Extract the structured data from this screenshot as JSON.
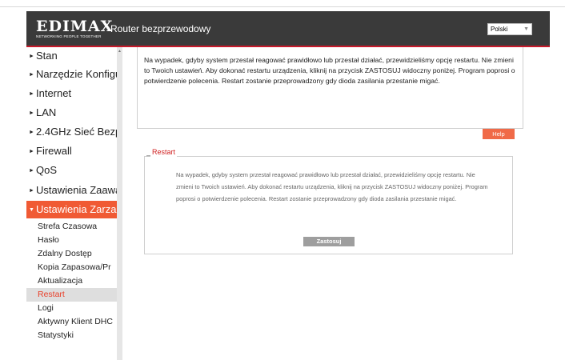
{
  "header": {
    "logo_text": "EDIMAX",
    "logo_tagline": "NETWORKING PEOPLE TOGETHER",
    "title": "Router bezprzewodowy",
    "language": "Polski"
  },
  "sidebar": {
    "items": [
      {
        "label": "Stan"
      },
      {
        "label": "Narzędzie Konfigu"
      },
      {
        "label": "Internet"
      },
      {
        "label": "LAN"
      },
      {
        "label": "2.4GHz Sieć Bezp"
      },
      {
        "label": "Firewall"
      },
      {
        "label": "QoS"
      },
      {
        "label": "Ustawienia Zaawa"
      },
      {
        "label": "Ustawienia Zarza"
      }
    ],
    "sub_items": [
      {
        "label": "Strefa Czasowa"
      },
      {
        "label": "Hasło"
      },
      {
        "label": "Zdalny Dostęp"
      },
      {
        "label": "Kopia Zapasowa/Pr"
      },
      {
        "label": "Aktualizacja"
      },
      {
        "label": "Restart"
      },
      {
        "label": "Logi"
      },
      {
        "label": "Aktywny Klient DHC"
      },
      {
        "label": "Statystyki"
      }
    ]
  },
  "info": {
    "text": "Na wypadek, gdyby system przestał reagować prawidłowo lub przestał działać, przewidzieliśmy opcję restartu. Nie zmieni to Twoich ustawień. Aby dokonać restartu urządzenia, kliknij na przycisk ZASTOSUJ widoczny poniżej. Program poprosi o potwierdzenie polecenia. Restart zostanie przeprowadzony gdy dioda zasilania przestanie migać."
  },
  "help_label": "Help",
  "restart": {
    "legend": "Restart",
    "text": "Na wypadek, gdyby system przestał reagować prawidłowo lub przestał działać, przewidzieliśmy opcję restartu. Nie zmieni to Twoich ustawień. Aby dokonać restartu urządzenia, kliknij na przycisk ZASTOSUJ widoczny poniżej. Program poprosi o potwierdzenie polecenia. Restart zostanie przeprowadzony gdy dioda zasilania przestanie migać.",
    "apply_label": "Zastosuj"
  },
  "colors": {
    "accent": "#f05a34",
    "header": "#3a3a3a",
    "legend": "#d02020"
  }
}
